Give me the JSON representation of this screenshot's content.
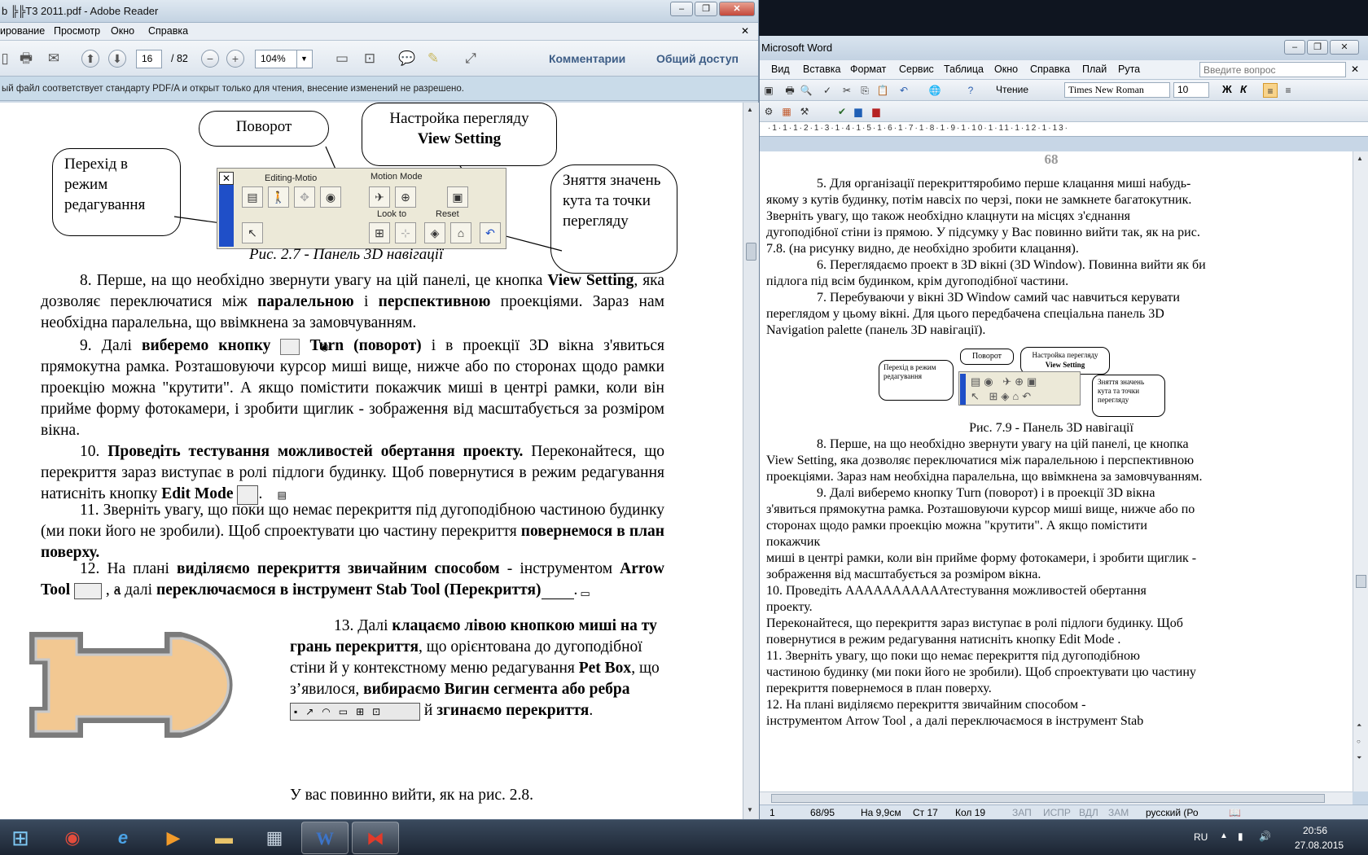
{
  "reader": {
    "title": "b ╠╠T3 2011.pdf - Adobe Reader",
    "menu": [
      "ирование",
      "Просмотр",
      "Окно",
      "Справка"
    ],
    "page_current": "16",
    "page_total": "/ 82",
    "zoom": "104%",
    "comments_label": "Комментарии",
    "share_label": "Общий доступ",
    "notice": "ый файл соответствует стандарту PDF/A и открыт только для чтения, внесение изменений не разрешено.",
    "figure": {
      "bubble_edit": "Перехід в режим редагування",
      "bubble_rotate": "Поворот",
      "bubble_view_line1": "Настройка перегляду",
      "bubble_view_line2": "View Setting",
      "bubble_reset": "Зняття значень кута та точки перегляду",
      "palette_editing": "Editing-Motio",
      "palette_motion": "Motion Mode",
      "palette_look": "Look to",
      "palette_reset": "Reset",
      "caption": "Рис. 2.7 - Панель 3D навігації"
    },
    "p8": {
      "t1": "8. Перше, на що необхідно звернути увагу на цій панелі, це кнопка ",
      "b1": "View Setting",
      "t2": ", яка дозволяє переключатися між ",
      "b2": "паралельною",
      "t3": " і ",
      "b3": "перспективною",
      "t4": " проекціями. Зараз нам необхідна паралельна, що ввімкнена за замовчуванням."
    },
    "p9": {
      "t1": "9. Далі ",
      "b1": "виберемо кнопку",
      "b2": " Turn (поворот)",
      "t2": " і в проекції 3D вікна з'явиться прямокутна рамка. Розташовуючи курсор миші вище, нижче або по сторонах щодо рамки проекцію можна \"крутити\". А якщо помістити покажчик миші в центрі рамки, коли він прийме форму фотокамери, і зробити щиглик - зображення від масштабується за розміром вікна."
    },
    "p10": {
      "t1": "10. ",
      "b1": "Проведіть тестування можливостей обертання проекту.",
      "t2": " Переконайтеся, що перекриття зараз виступає в ролі підлоги будинку. Щоб повернутися в режим редагування натисніть кнопку ",
      "b2": "Edit Mode",
      "t3": "."
    },
    "p11": {
      "t1": "11. Зверніть увагу, що поки що немає перекриття під дугоподібною частиною будинку (ми поки його не зробили). Щоб спроектувати цю частину перекриття ",
      "b1": "повернемося в план поверху."
    },
    "p12": {
      "t1": "12. На плані ",
      "b1": "виділяємо перекриття звичайним способом",
      "t2": " - інструментом ",
      "b2": "Arrow Tool",
      "t3": " , а далі ",
      "b3": "переключаємося в інструмент Stab Tool (Перекриття)",
      "t4": "."
    },
    "p13": {
      "t1": "13. Далі ",
      "b1": "клацаємо лівою кнопкою миші на ту грань перекриття",
      "t2": ", що орієнтована до дугоподібної стіни й у контекстному меню редагування ",
      "b2": "Pet Box",
      "t3": ", що з’явилося, ",
      "b3": "вибираємо Вигин сегмента або ребра",
      "t4": " й ",
      "b4": "згинаємо перекриття",
      "t5": "."
    },
    "p14": "У вас повинно вийти, як на рис. 2.8."
  },
  "word": {
    "title": "Microsoft Word",
    "menu": [
      "Вид",
      "Вставка",
      "Формат",
      "Сервис",
      "Таблица",
      "Окно",
      "Справка",
      "Плай",
      "Рута"
    ],
    "help_placeholder": "Введите вопрос",
    "reading_label": "Чтение",
    "font": "Times New Roman",
    "size": "10",
    "bold": "Ж",
    "italic": "К",
    "page_number": "68",
    "paragraphs": [
      "5. Для організації перекриттяробимо перше клацання миші набудь-",
      "якому з кутів будинку, потім навсіх по черзі, поки не замкнете багатокутник.",
      "Зверніть увагу, що також необхідно клацнути на місцях з'єднання",
      "дугоподібної стіни із прямою. У підсумку у Вас повинно вийти так, як на рис.",
      "7.8. (на рисунку видно, де необхідно зробити клацання).",
      "6. Переглядаємо проект в 3D вікні (3D Window). Повинна вийти як би",
      "підлога під всім будинком, крім дугоподібної частини.",
      "7. Перебуваючи у вікні 3D Window самий час навчиться керувати",
      "переглядом у цьому вікні. Для цього передбачена спеціальна панель 3D",
      "Navigation palette (панель 3D навігації)."
    ],
    "fig_caption": "Рис. 7.9 - Панель 3D навігації",
    "fig_bubble_edit": "Перехід в режим редагування",
    "fig_bubble_rotate": "Поворот",
    "fig_bubble_view1": "Настройка перегляду",
    "fig_bubble_view2": "View Setting",
    "fig_bubble_reset": "Зняття значень кута та точки перегляду",
    "lines_after": [
      "8. Перше, на що необхідно звернути увагу на цій панелі, це кнопка",
      "View Setting, яка дозволяє переключатися між паралельною і перспективною",
      "проекціями. Зараз нам необхідна паралельна, що ввімкнена за замовчуванням.",
      "9. Далі виберемо кнопку Turn (поворот) і в проекції 3D вікна",
      "з'явиться прямокутна рамка. Розташовуючи курсор миші вище, нижче або по",
      "сторонах щодо рамки проекцію можна \"крутити\". А якщо помістити",
      "покажчик",
      "миші в центрі рамки, коли він прийме форму фотокамери, і зробити щиглик -",
      "зображення від масштабується за розміром вікна.",
      "10. Проведіть АААААААААААтестування можливостей обертання",
      "проекту.",
      "Переконайтеся, що перекриття зараз виступає в ролі підлоги будинку. Щоб",
      "повернутися в режим редагування натисніть кнопку Edit Mode .",
      "11. Зверніть увагу, що поки що немає перекриття під дугоподібною",
      "частиною будинку (ми поки його не зробили). Щоб спроектувати цю частину",
      "перекриття повернемося в план поверху.",
      "12. На плані виділяємо перекриття звичайним способом -",
      "інструментом Arrow Tool , а далі переключаємося в інструмент Stab"
    ],
    "status": {
      "page": "1",
      "section": "68/95",
      "at": "На 9,9см",
      "line": "Ст 17",
      "col": "Кол 19",
      "rec": "ЗАП",
      "trk": "ИСПР",
      "ext": "ВДЛ",
      "ovr": "ЗАМ",
      "lang": "русский (Ро"
    }
  },
  "taskbar": {
    "lang": "RU",
    "time": "20:56",
    "date": "27.08.2015"
  }
}
